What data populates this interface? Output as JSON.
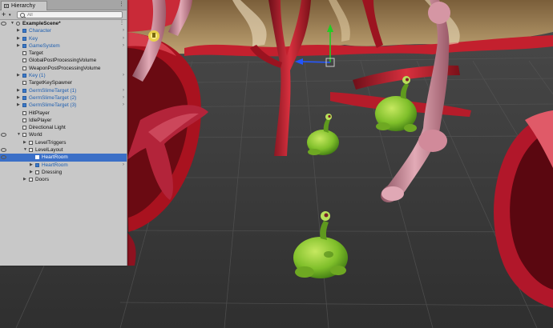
{
  "hierarchy": {
    "tab_label": "Hierarchy",
    "tab_icon": "list-icon",
    "tab_menu": "⋮",
    "create_label": "+",
    "create_caret": "▾",
    "search_value": "",
    "search_placeholder": "All",
    "rows": [
      {
        "label": "ExampleScene*",
        "type": "scene",
        "depth": 0,
        "expanded": true,
        "eye": true
      },
      {
        "label": "Character",
        "type": "prefab",
        "depth": 1,
        "collapsed": true,
        "more": true
      },
      {
        "label": "Key",
        "type": "prefab",
        "depth": 1,
        "collapsed": true,
        "more": true
      },
      {
        "label": "GameSystem",
        "type": "prefab",
        "depth": 1,
        "collapsed": true,
        "more": true
      },
      {
        "label": "Target",
        "type": "cube",
        "depth": 1
      },
      {
        "label": "GlobalPostProcessingVolume",
        "type": "cube",
        "depth": 1
      },
      {
        "label": "WeaponPostProcessingVolume",
        "type": "cube",
        "depth": 1
      },
      {
        "label": "Key (1)",
        "type": "prefab",
        "depth": 1,
        "collapsed": true,
        "more": true
      },
      {
        "label": "TargetKeySpawner",
        "type": "cube",
        "depth": 1
      },
      {
        "label": "GermSlimeTarget (1)",
        "type": "prefab",
        "depth": 1,
        "collapsed": true,
        "more": true
      },
      {
        "label": "GermSlimeTarget (2)",
        "type": "prefab",
        "depth": 1,
        "collapsed": true,
        "more": true
      },
      {
        "label": "GermSlimeTarget (3)",
        "type": "prefab",
        "depth": 1,
        "collapsed": true,
        "more": true
      },
      {
        "label": "HitPlayer",
        "type": "cube",
        "depth": 1
      },
      {
        "label": "IdlePlayer",
        "type": "cube",
        "depth": 1
      },
      {
        "label": "Directional Light",
        "type": "cube",
        "depth": 1
      },
      {
        "label": "World",
        "type": "cube",
        "depth": 1,
        "expanded": true,
        "eye": true
      },
      {
        "label": "LevelTriggers",
        "type": "cube",
        "depth": 2,
        "collapsed": true
      },
      {
        "label": "LevelLayout",
        "type": "cube",
        "depth": 2,
        "expanded": true,
        "eye": true
      },
      {
        "label": "HeartRoom",
        "type": "prefab",
        "depth": 3,
        "selected": true,
        "eye": true
      },
      {
        "label": "HeartRoom",
        "type": "prefab",
        "depth": 3,
        "collapsed": true,
        "more": true
      },
      {
        "label": "Dressing",
        "type": "cube",
        "depth": 3,
        "collapsed": true
      },
      {
        "label": "Doors",
        "type": "cube",
        "depth": 2,
        "collapsed": true
      }
    ]
  },
  "scene_view": {
    "description_icons": [
      "move-gizmo-icon",
      "light-gizmo-icon"
    ],
    "colors": {
      "floor": "#3c3c3c",
      "grid": "#505050",
      "flesh": "#b21d2a",
      "flesh_dark": "#6e0f19",
      "bone": "#c98a96",
      "slime": "#7fbf2a",
      "slime_dark": "#4e8a18",
      "tissue": "#9b7d52",
      "gizmo_y": "#22cc22",
      "gizmo_x": "#2255ff",
      "selection": "#3b6fc7"
    }
  }
}
